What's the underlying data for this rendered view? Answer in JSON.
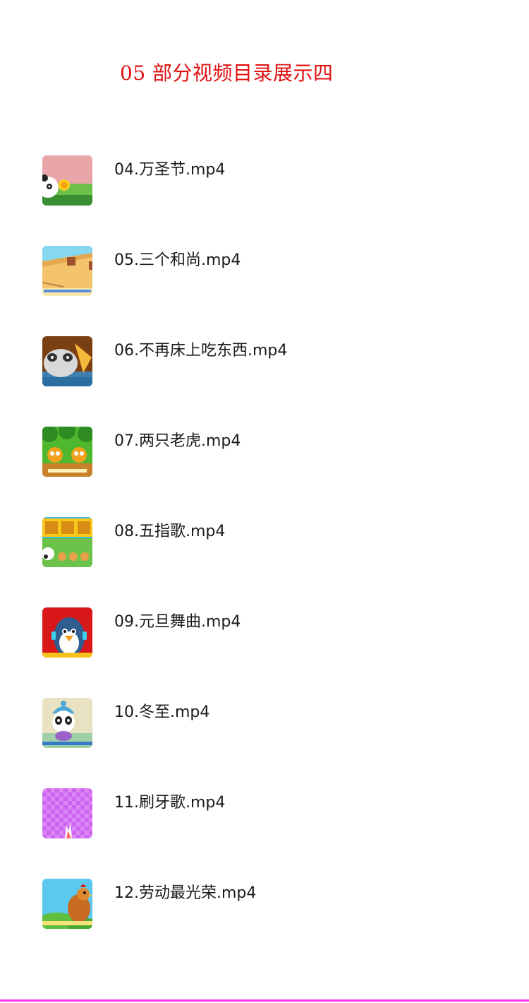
{
  "header": {
    "title": "05 部分视频目录展示四"
  },
  "videos": [
    {
      "name": "04.万圣节.mp4",
      "thumb_icon": "panda-sun-thumbnail-icon"
    },
    {
      "name": "05.三个和尚.mp4",
      "thumb_icon": "desert-bucket-thumbnail-icon"
    },
    {
      "name": "06.不再床上吃东西.mp4",
      "thumb_icon": "panda-bed-thumbnail-icon"
    },
    {
      "name": "07.两只老虎.mp4",
      "thumb_icon": "tigers-thumbnail-icon"
    },
    {
      "name": "08.五指歌.mp4",
      "thumb_icon": "five-finger-song-thumbnail-icon"
    },
    {
      "name": "09.元旦舞曲.mp4",
      "thumb_icon": "penguin-thumbnail-icon"
    },
    {
      "name": "10.冬至.mp4",
      "thumb_icon": "panda-winter-hat-thumbnail-icon"
    },
    {
      "name": "11.刷牙歌.mp4",
      "thumb_icon": "purple-checker-thumbnail-icon"
    },
    {
      "name": "12.劳动最光荣.mp4",
      "thumb_icon": "rooster-thumbnail-icon"
    }
  ],
  "colors": {
    "title": "#e01010",
    "bottom_line": "#ff33ee"
  }
}
